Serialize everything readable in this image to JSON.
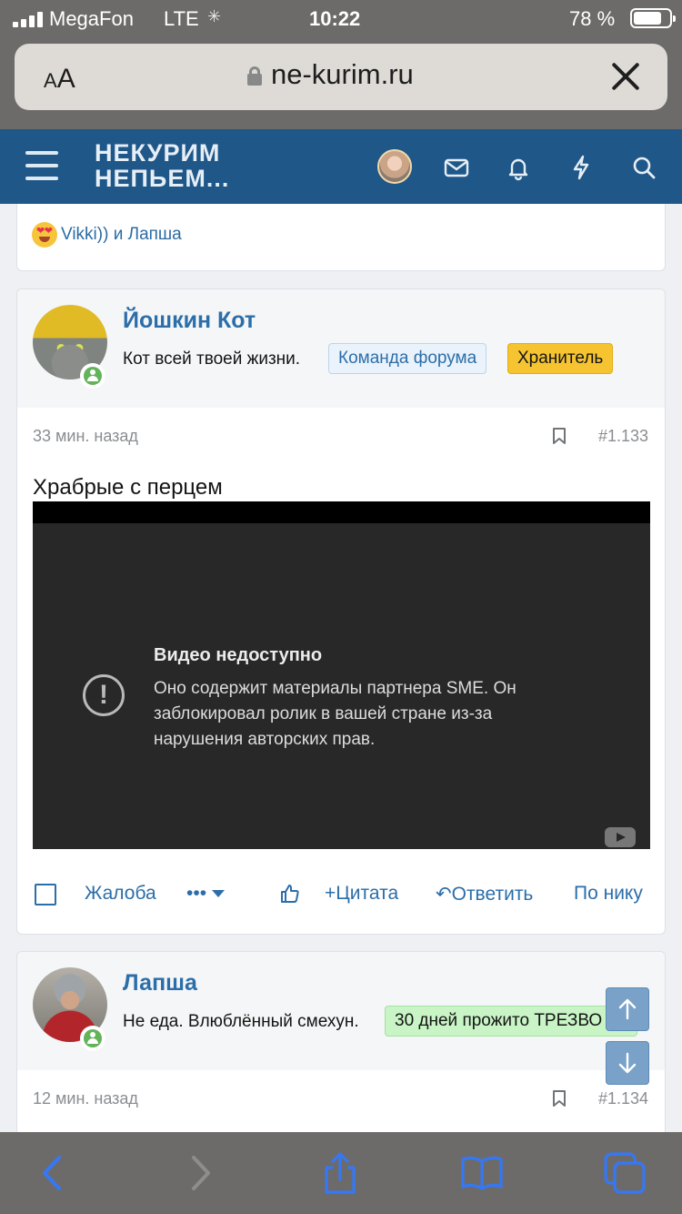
{
  "status_bar": {
    "carrier": "MegaFon",
    "network": "LTE",
    "time": "10:22",
    "battery": "78 %"
  },
  "browser": {
    "text_size_button": "AA",
    "domain": "ne-kurim.ru"
  },
  "site_header": {
    "logo_line1": "НЕКУРИМ",
    "logo_line2": "НЕПЬЕМ..."
  },
  "previous_post": {
    "reactions_text": "Vikki)) и Лапша"
  },
  "posts": [
    {
      "username": "Йошкин Кот",
      "user_title": "Кот всей твоей жизни.",
      "badges": [
        "Команда форума",
        "Хранитель"
      ],
      "time": "33 мин. назад",
      "number": "#1.133",
      "text": "Храбрые с перцем",
      "video": {
        "title": "Видео недоступно",
        "message": "Оно содержит материалы партнера SME. Он заблокировал ролик в вашей стране из-за нарушения авторских прав."
      },
      "actions": {
        "report": "Жалоба",
        "more": "•••",
        "quote": "Цитата",
        "reply": "Ответить",
        "by_nick": "По нику"
      }
    },
    {
      "username": "Лапша",
      "user_title": "Не еда. Влюблённый смехун.",
      "badges": [
        "30 дней прожито ТРЕЗВО"
      ],
      "time": "12 мин. назад",
      "number": "#1.134"
    }
  ],
  "icons": [
    "hamburger-icon",
    "mail-icon",
    "bell-icon",
    "lightning-icon",
    "search-icon",
    "bookmark-icon",
    "like-icon",
    "arrow-up-icon",
    "arrow-down-icon",
    "back-icon",
    "forward-icon",
    "share-icon",
    "bookmarks-icon",
    "tabs-icon"
  ],
  "colors": {
    "header_bg": "#1f5788",
    "link": "#2b6ea9",
    "badge_keeper": "#f6c431",
    "badge_sober": "#c8f4c6",
    "online": "#63b35a",
    "ios_accent": "#3478f6"
  }
}
